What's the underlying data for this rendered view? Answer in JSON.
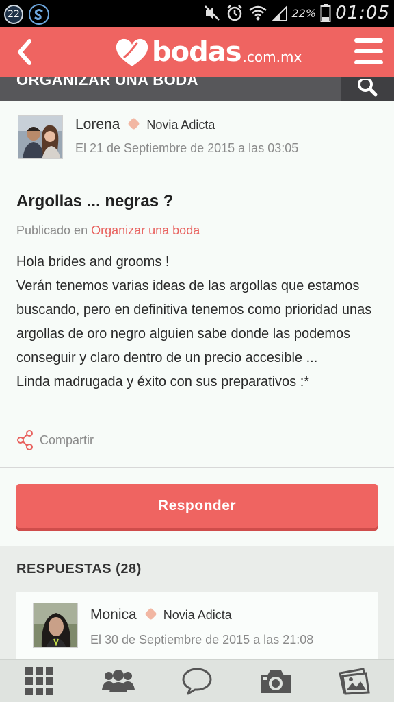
{
  "status_bar": {
    "notification_count": "22",
    "battery": "22%",
    "time": "01:05"
  },
  "app_bar": {
    "logo_word": "bodas",
    "logo_domain": ".com.mx"
  },
  "category_bar": {
    "title": "ORGANIZAR UNA BODA"
  },
  "post": {
    "author": {
      "name": "Lorena",
      "level": "Novia Adicta",
      "date": "El 21 de Septiembre de 2015 a las 03:05"
    },
    "title": "Argollas ... negras ?",
    "published_prefix": "Publicado en",
    "category_link": "Organizar una boda",
    "body_lines": [
      "Hola brides and grooms !",
      "Verán tenemos varias ideas de las argollas que estamos buscando, pero en definitiva tenemos como prioridad unas argollas de oro negro alguien sabe donde las podemos conseguir y claro dentro de un precio accesible ...",
      "Linda madrugada y éxito con sus preparativos :*"
    ],
    "share_label": "Compartir"
  },
  "reply_button_label": "Responder",
  "responses": {
    "title": "RESPUESTAS (28)",
    "items": [
      {
        "name": "Monica",
        "level": "Novia Adicta",
        "date": "El 30 de Septiembre de 2015 a las 21:08"
      }
    ]
  },
  "colors": {
    "brand": "#ef6461",
    "category_bar": "#57575a",
    "link": "#e8625f",
    "level_dot": "#f2b7a3"
  },
  "bottom_nav": [
    "grid-icon",
    "community-icon",
    "chat-icon",
    "camera-icon",
    "photos-icon"
  ]
}
